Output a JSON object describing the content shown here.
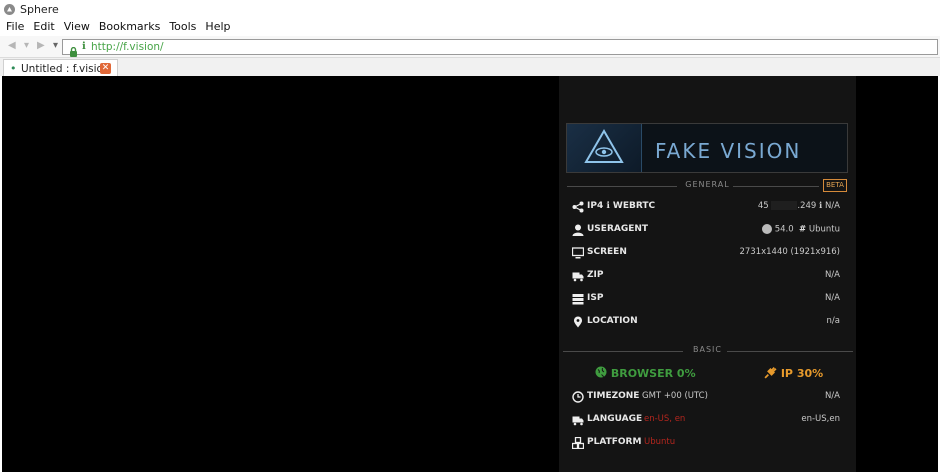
{
  "window": {
    "title": "Sphere"
  },
  "menu": [
    "File",
    "Edit",
    "View",
    "Bookmarks",
    "Tools",
    "Help"
  ],
  "nav": {
    "url": "http://f.vision/"
  },
  "tab": {
    "title": "Untitled : f.vision"
  },
  "page": {
    "banner_text": "FAKE VISION",
    "general_label": "GENERAL",
    "beta_label": "BETA",
    "basic_label": "BASIC",
    "rows": {
      "ip": {
        "label": "IP4 ℹ WEBRTC",
        "value_prefix": "45",
        "value_suffix": ".249 ℹ N/A"
      },
      "useragent": {
        "label": "USERAGENT",
        "browser_version": "54.0",
        "os": "Ubuntu"
      },
      "screen": {
        "label": "SCREEN",
        "value": "2731x1440 (1921x916)"
      },
      "zip": {
        "label": "ZIP",
        "value": "N/A"
      },
      "isp": {
        "label": "ISP",
        "value": "N/A"
      },
      "location": {
        "label": "LOCATION",
        "value": "n/a"
      }
    },
    "browser_status": "BROWSER 0%",
    "ip_status": "IP 30%",
    "basic_rows": {
      "timezone": {
        "label": "TIMEZONE",
        "detail": "GMT +00 (UTC)",
        "value": "N/A"
      },
      "language": {
        "label": "LANGUAGE",
        "detail": "en-US, en",
        "value": "en-US,en"
      },
      "platform": {
        "label": "PLATFORM",
        "detail": "Ubuntu",
        "value": ""
      }
    }
  },
  "colors": {
    "accent_green": "#47a447",
    "browser_green": "#3f9c3f",
    "ip_orange": "#e79a2c",
    "alert_red": "#b3261e"
  },
  "icons": [
    "app-icon",
    "back-icon",
    "forward-icon",
    "dropdown-icon",
    "lock-icon",
    "info-icon",
    "close-icon",
    "eye-pyramid-icon",
    "share-icon",
    "user-icon",
    "monitor-icon",
    "truck-icon",
    "server-icon",
    "map-pin-icon",
    "globe-icon",
    "plug-icon",
    "clock-icon",
    "cubes-icon",
    "firefox-icon",
    "hash-icon"
  ]
}
